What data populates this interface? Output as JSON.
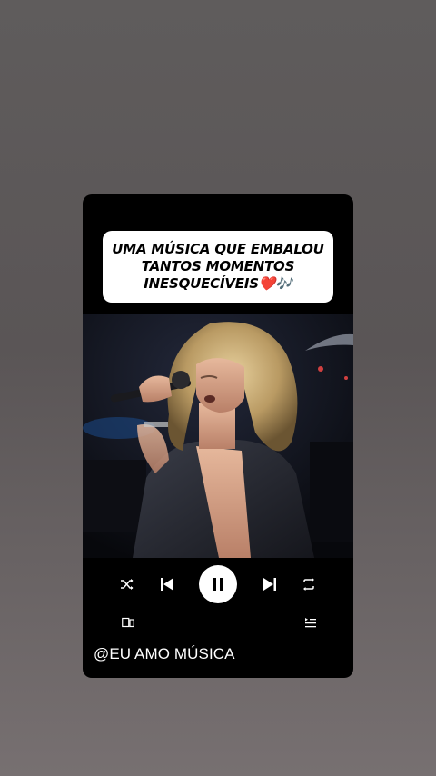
{
  "post": {
    "caption_line1": "UMA MÚSICA QUE EMBALOU",
    "caption_line2": "TANTOS MOMENTOS",
    "caption_line3": "INESQUECÍVEIS❤️🎶",
    "handle": "@EU AMO MÚSICA"
  },
  "player": {
    "state": "playing",
    "shuffle_icon": "shuffle-icon",
    "prev_icon": "skip-previous-icon",
    "pause_icon": "pause-icon",
    "next_icon": "skip-next-icon",
    "repeat_icon": "repeat-icon",
    "devices_icon": "devices-icon",
    "queue_icon": "queue-icon"
  },
  "colors": {
    "background": "#5f5c5c",
    "card": "#000000",
    "caption_bg": "#ffffff",
    "controls": "#ffffff"
  }
}
